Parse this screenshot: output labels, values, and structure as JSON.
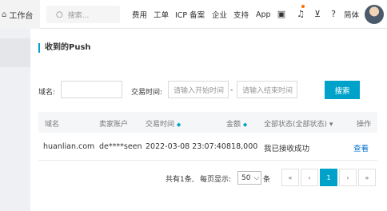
{
  "topbar": {
    "workbench": "工作台",
    "search_placeholder": "搜索...",
    "nav": [
      "费用",
      "工单",
      "ICP 备案",
      "企业",
      "支持",
      "App"
    ],
    "lang": "简体"
  },
  "page": {
    "title": "收到的Push"
  },
  "filters": {
    "domain_label": "域名:",
    "time_label": "交易时间:",
    "start_placeholder": "请输入开始时间",
    "end_placeholder": "请输入结束时间",
    "sep": "-",
    "search_btn": "搜索"
  },
  "table": {
    "headers": [
      "域名",
      "卖家账户",
      "交易时间",
      "金额",
      "全部状态(全部状态)",
      "操作"
    ],
    "rows": [
      {
        "domain": "huanlian.com",
        "seller": "de****seen",
        "time": "2022-03-08 23:07:40",
        "amount": "818,000",
        "status": "我已接收成功",
        "action": "查看"
      }
    ]
  },
  "pagination": {
    "summary": "共有1条,",
    "per_page_label": "每页显示:",
    "per_page": "50",
    "unit": "条",
    "first": "«",
    "prev": "‹",
    "current": "1",
    "next": "›",
    "last": "»"
  }
}
